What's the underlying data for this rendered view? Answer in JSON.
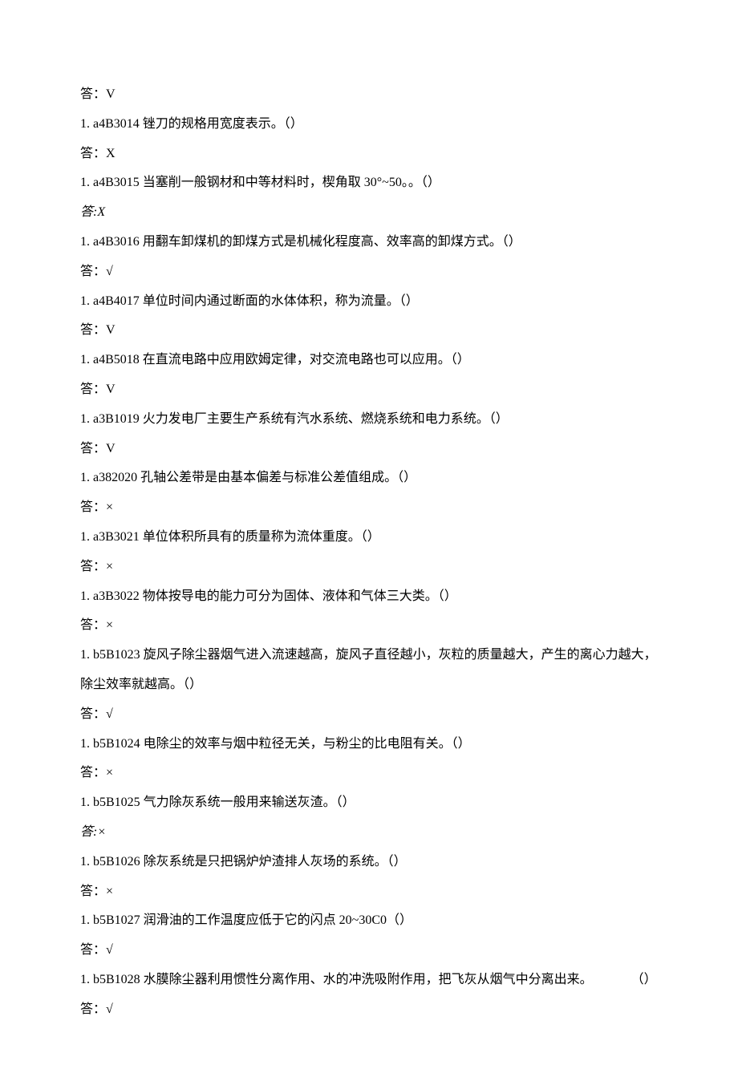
{
  "lines": [
    {
      "text": "答：V",
      "italic": false
    },
    {
      "text": "1. a4B3014 锉刀的规格用宽度表示。（）",
      "italic": false
    },
    {
      "text": "答：X",
      "italic": false
    },
    {
      "text": "1. a4B3015 当塞削一般钢材和中等材料时，楔角取 30°~50。。（）",
      "italic": false
    },
    {
      "text": "答:X",
      "italic": true
    },
    {
      "text": "1. a4B3016 用翻车卸煤机的卸煤方式是机械化程度高、效率高的卸煤方式。（）",
      "italic": false
    },
    {
      "text": "答：√",
      "italic": false
    },
    {
      "text": "1. a4B4017 单位时间内通过断面的水体体积，称为流量。（）",
      "italic": false
    },
    {
      "text": "答：V",
      "italic": false
    },
    {
      "text": "1. a4B5018 在直流电路中应用欧姆定律，对交流电路也可以应用。（）",
      "italic": false
    },
    {
      "text": "答：V",
      "italic": false
    },
    {
      "text": "1. a3B1019 火力发电厂主要生产系统有汽水系统、燃烧系统和电力系统。（）",
      "italic": false
    },
    {
      "text": "答：V",
      "italic": false
    },
    {
      "text": "1. a382020 孔轴公差带是由基本偏差与标准公差值组成。（）",
      "italic": false
    },
    {
      "text": "答：×",
      "italic": false
    },
    {
      "text": "1. a3B3021 单位体积所具有的质量称为流体重度。（）",
      "italic": false
    },
    {
      "text": "答：×",
      "italic": false
    },
    {
      "text": "1. a3B3022 物体按导电的能力可分为固体、液体和气体三大类。（）",
      "italic": false
    },
    {
      "text": "答：×",
      "italic": false
    },
    {
      "text": "1. b5B1023 旋风子除尘器烟气进入流速越高，旋风子直径越小，灰粒的质量越大，产生的离心力越大，除尘效率就越高。（）",
      "italic": false
    },
    {
      "text": "答：√",
      "italic": false
    },
    {
      "text": "1. b5B1024 电除尘的效率与烟中粒径无关，与粉尘的比电阻有关。（）",
      "italic": false
    },
    {
      "text": "答：×",
      "italic": false
    },
    {
      "text": "1. b5B1025 气力除灰系统一般用来输送灰渣。（）",
      "italic": false
    },
    {
      "text": "答:×",
      "italic": true
    },
    {
      "text": "1. b5B1026 除灰系统是只把锅炉炉渣排人灰场的系统。（）",
      "italic": false
    },
    {
      "text": "答：×",
      "italic": false
    },
    {
      "text": "1. b5B1027 润滑油的工作温度应低于它的闪点 20~30C0（）",
      "italic": false
    },
    {
      "text": "答：√",
      "italic": false
    },
    {
      "text": "1. b5B1028 水膜除尘器利用惯性分离作用、水的冲洗吸附作用，把飞灰从烟气中分离出来。　　　　（）",
      "italic": false
    },
    {
      "text": "答：√",
      "italic": false
    }
  ]
}
